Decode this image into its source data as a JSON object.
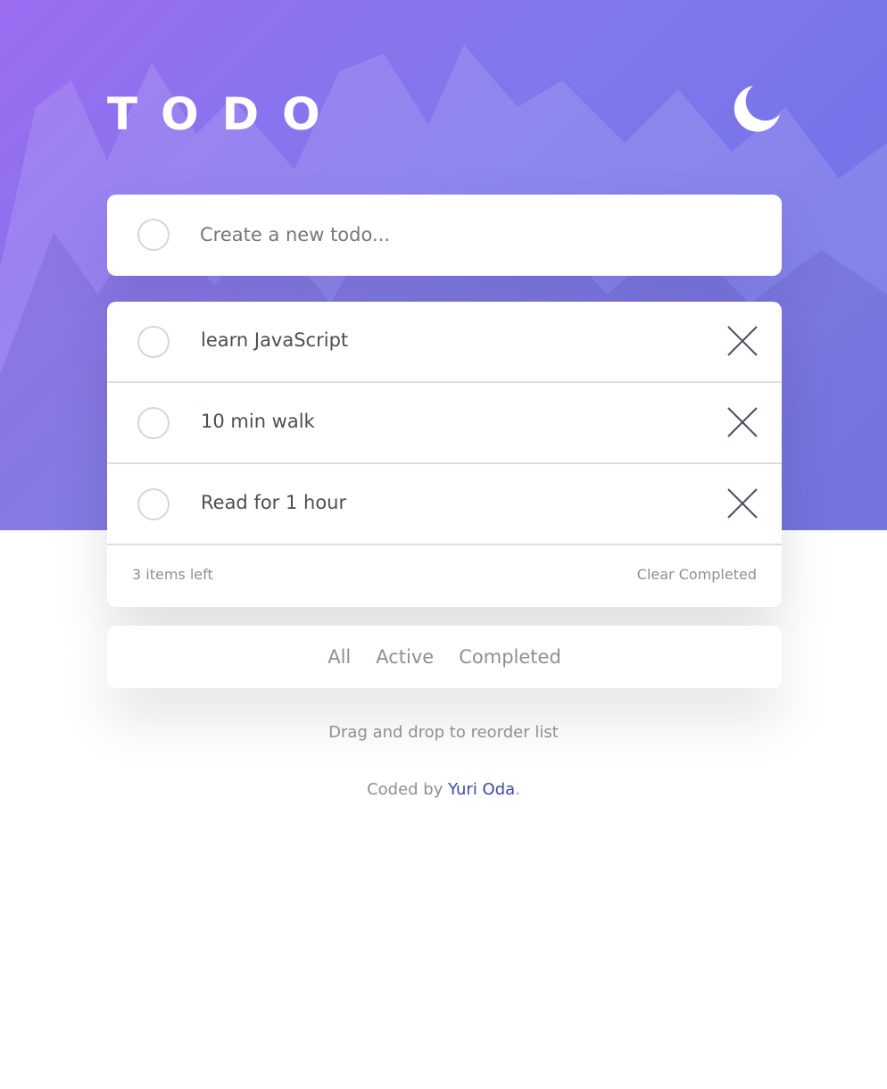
{
  "header": {
    "title": "TODO",
    "theme_icon": "moon-icon"
  },
  "new_todo": {
    "placeholder": "Create a new todo...",
    "value": ""
  },
  "todos": [
    {
      "text": "learn JavaScript",
      "completed": false
    },
    {
      "text": "10 min walk",
      "completed": false
    },
    {
      "text": "Read for 1 hour",
      "completed": false
    }
  ],
  "list_footer": {
    "items_left": "3 items left",
    "clear_label": "Clear Completed"
  },
  "filters": {
    "all": "All",
    "active": "Active",
    "completed": "Completed"
  },
  "hint": "Drag and drop to reorder list",
  "credit": {
    "prefix": "Coded by ",
    "author": "Yuri Oda",
    "suffix": "."
  },
  "colors": {
    "accent_gradient_start": "#9a6cf0",
    "accent_gradient_end": "#6b6fe6",
    "link": "#3d4ba0"
  }
}
